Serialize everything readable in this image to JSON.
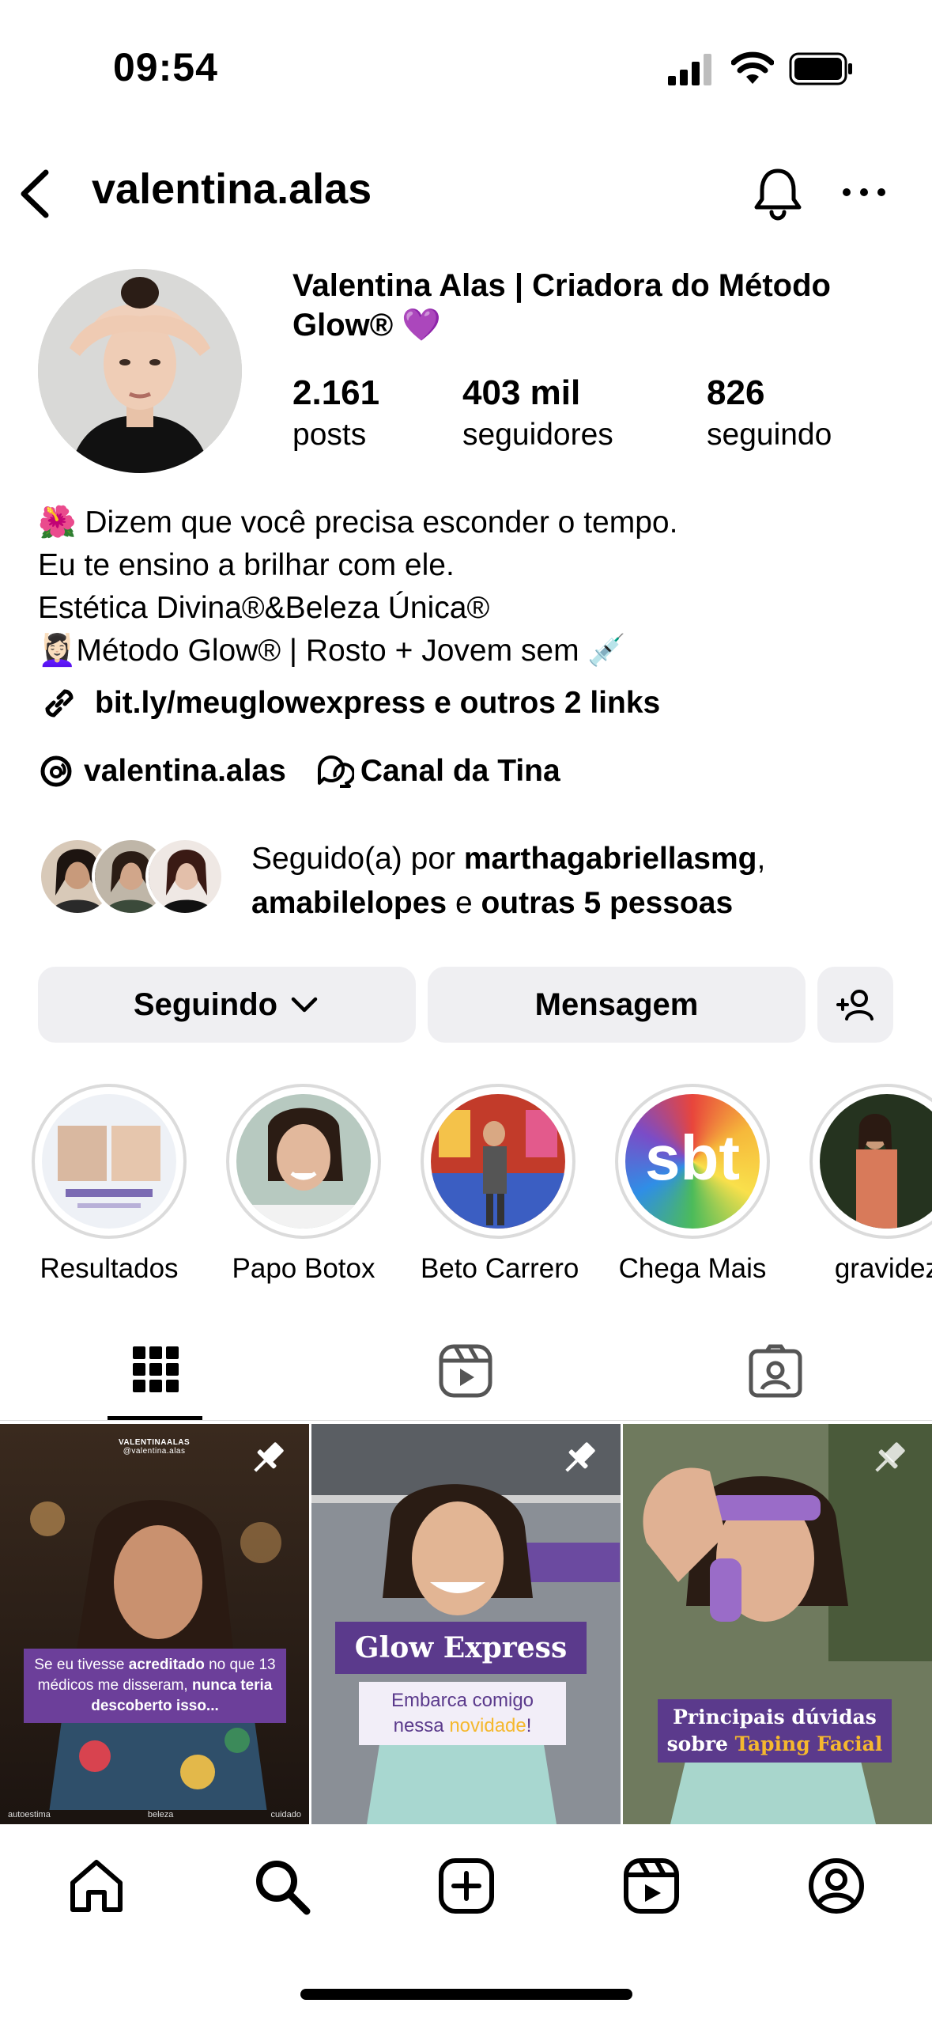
{
  "status_bar": {
    "time": "09:54"
  },
  "header": {
    "username": "valentina.alas"
  },
  "profile": {
    "full_name": "Valentina Alas | Criadora do Método Glow® 💜",
    "stats": [
      {
        "value": "2.161",
        "label": "posts"
      },
      {
        "value": "403 mil",
        "label": "seguidores"
      },
      {
        "value": "826",
        "label": "seguindo"
      }
    ],
    "bio_lines": [
      "🌺 Dizem que você precisa esconder o tempo.",
      "Eu te ensino a brilhar com ele.",
      "Estética Divina®&Beleza Única®",
      "💆🏻‍♀️Método Glow® | Rosto + Jovem sem 💉"
    ],
    "link_text": "bit.ly/meuglowexpress e outros 2 links",
    "threads_handle": "valentina.alas",
    "channel_label": "Canal da Tina",
    "followed_by": {
      "prefix": "Seguido(a) por ",
      "user1": "marthagabriellasmg",
      "comma": ",",
      "user2": "amabilelopes",
      "middle": " e ",
      "others": "outras 5 pessoas"
    }
  },
  "buttons": {
    "following": "Seguindo",
    "message": "Mensagem"
  },
  "highlights": [
    {
      "label": "Resultados"
    },
    {
      "label": "Papo Botox"
    },
    {
      "label": "Beto Carrero"
    },
    {
      "label": "Chega Mais"
    },
    {
      "label": "gravidez"
    }
  ],
  "highlight_sbt_text": "sbt",
  "posts": [
    {
      "brand": "VALENTINAALAS",
      "handle": "@valentina.alas",
      "caption_parts": [
        "Se eu tivesse ",
        "acreditado",
        " no que 13 médicos me disseram, ",
        "nunca teria descoberto isso..."
      ],
      "footer": [
        "autoestima",
        "beleza",
        "cuidado"
      ]
    },
    {
      "title": "Glow Express",
      "subtitle_1": "Embarca comigo",
      "subtitle_2": "nessa ",
      "subtitle_highlight": "novidade",
      "subtitle_end": "!"
    },
    {
      "title_1": "Principais dúvidas",
      "title_2": "sobre ",
      "title_highlight": "Taping Facial"
    }
  ],
  "colors": {
    "accent_purple": "#5b3a8c",
    "button_bg": "#efeff2",
    "highlight_yellow": "#f5b82e"
  }
}
